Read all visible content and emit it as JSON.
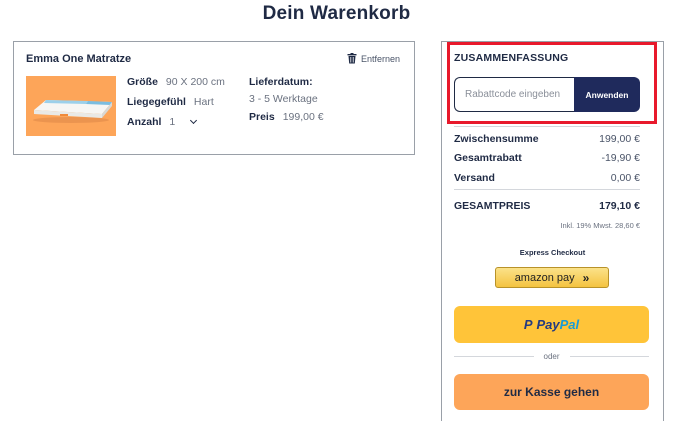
{
  "page": {
    "title": "Dein Warenkorb"
  },
  "cart_item": {
    "name": "Emma One Matratze",
    "remove_label": "Entfernen",
    "image_icon": "mattress-image",
    "attributes": {
      "size_label": "Größe",
      "size_value": "90 X 200 cm",
      "firmness_label": "Liegegefühl",
      "firmness_value": "Hart",
      "quantity_label": "Anzahl",
      "quantity_value": "1",
      "delivery_label": "Lieferdatum:",
      "delivery_value": "3 - 5 Werktage",
      "price_label": "Preis",
      "price_value": "199,00 €"
    }
  },
  "summary": {
    "title": "ZUSAMMENFASSUNG",
    "coupon_placeholder": "Rabattcode eingeben",
    "apply_label": "Anwenden",
    "rows": [
      {
        "label": "Zwischensumme",
        "value": "199,00 €"
      },
      {
        "label": "Gesamtrabatt",
        "value": "-19,90 €"
      },
      {
        "label": "Versand",
        "value": "0,00 €"
      }
    ],
    "total_label": "GESAMTPREIS",
    "total_value": "179,10 €",
    "tax_note": "Inkl. 19% Mwst. 28,60 €",
    "express_label": "Express Checkout",
    "amazon_label": "amazon pay",
    "amazon_chevron": "»",
    "paypal_label_a": "Pay",
    "paypal_label_b": "Pal",
    "or_label": "oder",
    "checkout_label": "zur Kasse gehen"
  },
  "colors": {
    "navy": "#1f2a5c",
    "highlight": "#e8192c",
    "orange": "#fda559",
    "paypal_yellow": "#ffc439"
  }
}
